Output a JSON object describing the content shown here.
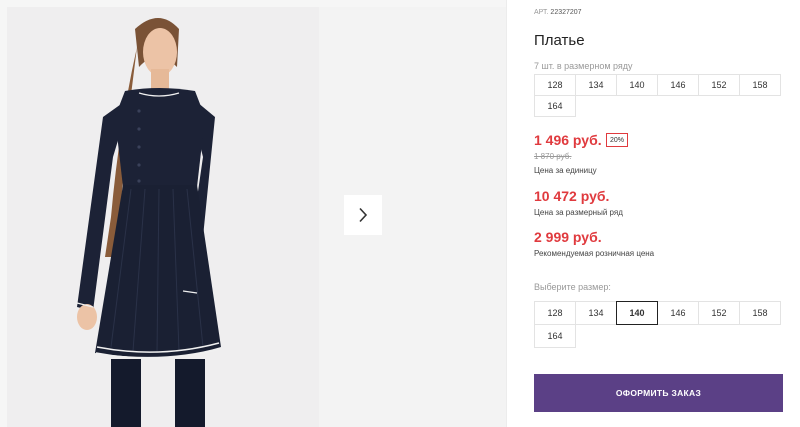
{
  "product": {
    "article_label": "АРТ.",
    "article_value": "22327207",
    "title": "Платье"
  },
  "range": {
    "hint": "7 шт. в размерном ряду",
    "sizes": [
      "128",
      "134",
      "140",
      "146",
      "152",
      "158",
      "164"
    ]
  },
  "pricing": {
    "price": "1 496 руб.",
    "discount": "20%",
    "old_price": "1 870 руб.",
    "price_caption": "Цена за единицу",
    "range_price": "10 472 руб.",
    "range_caption": "Цена за размерный ряд",
    "retail_price": "2 999 руб.",
    "retail_caption": "Рекомендуемая розничная цена"
  },
  "select": {
    "hint": "Выберите размер:",
    "sizes": [
      "128",
      "134",
      "140",
      "146",
      "152",
      "158",
      "164"
    ],
    "selected": "140"
  },
  "order_button": "ОФОРМИТЬ ЗАКАЗ",
  "colors": {
    "price_red": "#e03a3e",
    "button_purple": "#5b4086",
    "dress_navy": "#1c2236"
  },
  "icons": {
    "next": "chevron-right-icon"
  }
}
